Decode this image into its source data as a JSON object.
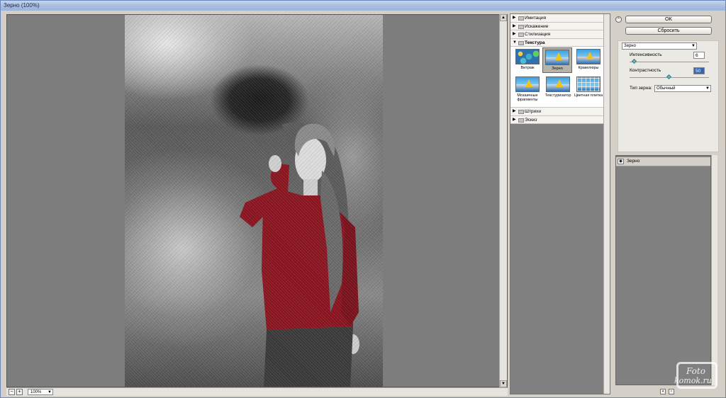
{
  "window": {
    "title": "Зерно (100%)"
  },
  "statusbar": {
    "zoom_out": "−",
    "zoom_in": "+",
    "zoom_value": "100%"
  },
  "gallery": {
    "categories_top": [
      {
        "label": "Имитация"
      },
      {
        "label": "Искажение"
      },
      {
        "label": "Стилизация"
      }
    ],
    "open_category": "Текстура",
    "thumbnails": [
      {
        "label": "Витраж"
      },
      {
        "label": "Зерно"
      },
      {
        "label": "Кракелюры"
      },
      {
        "label": "Мозаичные фрагменты"
      },
      {
        "label": "Текстуризатор"
      },
      {
        "label": "Цветная плитка"
      }
    ],
    "categories_bottom": [
      {
        "label": "Штрихи"
      },
      {
        "label": "Эскиз"
      }
    ]
  },
  "right_panel": {
    "ok_label": "OK",
    "reset_label": "Сбросить",
    "filter_select": "Зерно",
    "intensity_label": "Интенсивность",
    "intensity_value": "6",
    "contrast_label": "Контрастность",
    "contrast_value": "50",
    "grain_type_label": "Тип зерна:",
    "grain_type_value": "Обычный",
    "layer_name": "Зерно"
  },
  "slider_levels": {
    "intensity": 0.06,
    "contrast": 0.5
  },
  "watermark": {
    "line1": "Foto",
    "line2": "komok.ru"
  }
}
